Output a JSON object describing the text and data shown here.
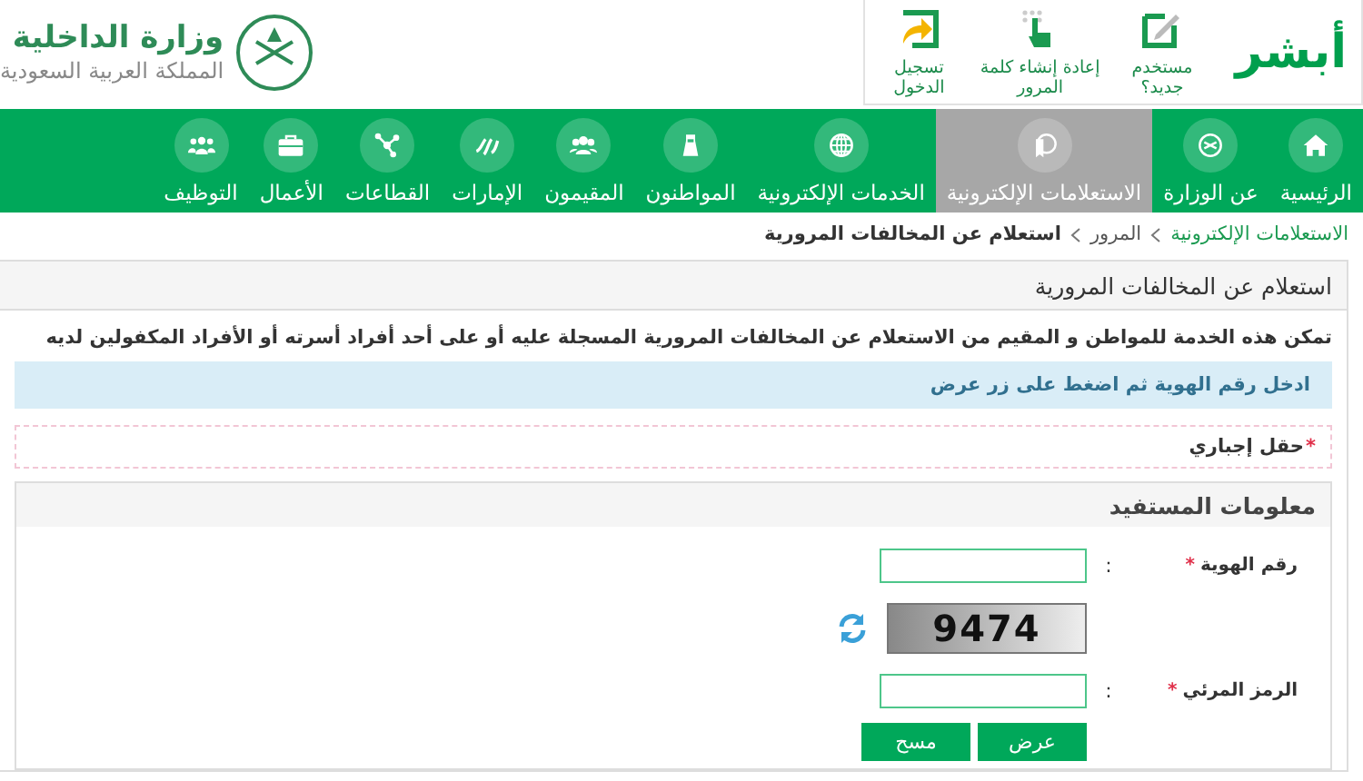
{
  "header": {
    "ministry_title": "وزارة الداخلية",
    "ministry_subtitle": "المملكة العربية السعودية",
    "logo_text": "أبشر",
    "links": [
      {
        "label": "مستخدم جديد؟"
      },
      {
        "label": "إعادة إنشاء كلمة المرور"
      },
      {
        "label": "تسجيل الدخول"
      }
    ]
  },
  "nav": [
    {
      "label": "الرئيسية",
      "selected": false
    },
    {
      "label": "عن الوزارة",
      "selected": false
    },
    {
      "label": "الاستعلامات الإلكترونية",
      "selected": true
    },
    {
      "label": "الخدمات الإلكترونية",
      "selected": false
    },
    {
      "label": "المواطنون",
      "selected": false
    },
    {
      "label": "المقيمون",
      "selected": false
    },
    {
      "label": "الإمارات",
      "selected": false
    },
    {
      "label": "القطاعات",
      "selected": false
    },
    {
      "label": "الأعمال",
      "selected": false
    },
    {
      "label": "التوظيف",
      "selected": false
    }
  ],
  "breadcrumb": [
    {
      "label": "الاستعلامات الإلكترونية",
      "kind": "link"
    },
    {
      "label": "المرور",
      "kind": "plain"
    },
    {
      "label": "استعلام عن المخالفات المرورية",
      "kind": "current"
    }
  ],
  "panel": {
    "title": "استعلام عن المخالفات المرورية",
    "description": "تمكن هذه الخدمة للمواطن و المقيم من الاستعلام عن المخالفات المرورية المسجلة عليه أو على أحد أفراد أسرته أو الأفراد المكفولين لديه",
    "info": "ادخل رقم الهوية ثم اضغط على زر عرض",
    "required_mark": "*",
    "required_note": "حقل إجباري",
    "beneficiary": {
      "title": "معلومات المستفيد",
      "rows": [
        {
          "kind": "field",
          "label": "رقم الهوية",
          "required_mark": "*",
          "separator": ":"
        },
        {
          "kind": "captcha",
          "captcha_text": "9474"
        },
        {
          "kind": "field",
          "label": "الرمز المرئي",
          "required_mark": "*",
          "separator": ":"
        }
      ],
      "buttons": [
        "عرض",
        "مسح"
      ]
    }
  }
}
